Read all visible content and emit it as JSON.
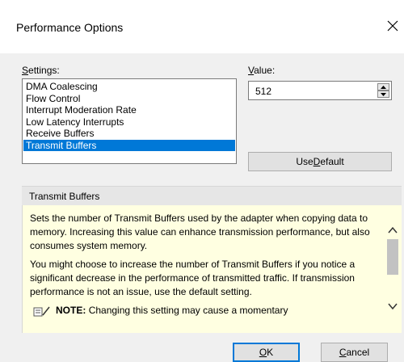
{
  "window": {
    "title": "Performance Options",
    "close_glyph": "✕"
  },
  "settings": {
    "label": "Settings:",
    "items": [
      {
        "label": "DMA Coalescing",
        "selected": false
      },
      {
        "label": "Flow Control",
        "selected": false
      },
      {
        "label": "Interrupt Moderation Rate",
        "selected": false
      },
      {
        "label": "Low Latency Interrupts",
        "selected": false
      },
      {
        "label": "Receive Buffers",
        "selected": false
      },
      {
        "label": "Transmit Buffers",
        "selected": true
      }
    ]
  },
  "value": {
    "label": "Value:",
    "current": "512"
  },
  "use_default": {
    "label": "Use Default"
  },
  "description": {
    "header": "Transmit Buffers",
    "paragraph1": "Sets the number of Transmit Buffers used by the adapter when copying data to memory. Increasing this value can enhance transmission performance, but also consumes system memory.",
    "paragraph2": "You might choose to increase the number of Transmit Buffers if you notice a significant decrease in the performance of transmitted traffic. If transmission performance is not an issue, use the default setting.",
    "note_label": "NOTE:",
    "note_text": "Changing this setting may cause a momentary"
  },
  "buttons": {
    "ok": "OK",
    "cancel": "Cancel"
  },
  "colors": {
    "selection": "#0078d7",
    "description_bg": "#ffffe1",
    "dialog_bg": "#f0f0f0"
  }
}
